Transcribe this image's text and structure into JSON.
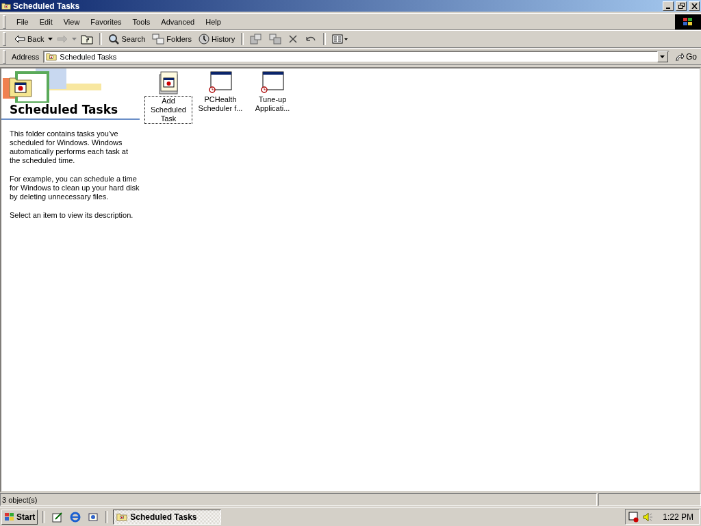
{
  "window": {
    "title": "Scheduled Tasks"
  },
  "menu": [
    "File",
    "Edit",
    "View",
    "Favorites",
    "Tools",
    "Advanced",
    "Help"
  ],
  "toolbar": [
    {
      "kind": "back",
      "label": "Back",
      "disabled": false
    },
    {
      "kind": "forward",
      "disabled": true
    },
    {
      "kind": "up",
      "disabled": false
    },
    {
      "kind": "separator"
    },
    {
      "kind": "search",
      "label": "Search",
      "disabled": false
    },
    {
      "kind": "folders",
      "label": "Folders",
      "disabled": false
    },
    {
      "kind": "history",
      "label": "History",
      "disabled": false
    },
    {
      "kind": "separator"
    },
    {
      "kind": "move",
      "disabled": false
    },
    {
      "kind": "copy",
      "disabled": false
    },
    {
      "kind": "delete",
      "disabled": false
    },
    {
      "kind": "undo",
      "disabled": false
    },
    {
      "kind": "separator"
    },
    {
      "kind": "views",
      "disabled": false
    }
  ],
  "address": {
    "label": "Address",
    "value": "Scheduled Tasks",
    "go": "Go"
  },
  "info_pane": {
    "title": "Scheduled Tasks",
    "paragraphs": [
      "This folder contains tasks you've scheduled for Windows. Windows automatically performs each task at the scheduled time.",
      "For example, you can schedule a time for Windows to clean up your hard disk by deleting unnecessary files.",
      "Select an item to view its description."
    ]
  },
  "items": [
    {
      "kind": "wizard",
      "label": "Add Scheduled Task",
      "focused": true
    },
    {
      "kind": "task",
      "label": "PCHealth Scheduler f...",
      "focused": false
    },
    {
      "kind": "task",
      "label": "Tune-up Applicati...",
      "focused": false
    }
  ],
  "status_bar": {
    "text": "3 object(s)"
  },
  "taskbar": {
    "start": "Start",
    "quick_launch": [
      {
        "kind": "desktop"
      },
      {
        "kind": "browser"
      },
      {
        "kind": "channels"
      }
    ],
    "tasks": [
      {
        "label": "Scheduled Tasks",
        "selected": true
      }
    ],
    "clock": "1:22 PM"
  }
}
